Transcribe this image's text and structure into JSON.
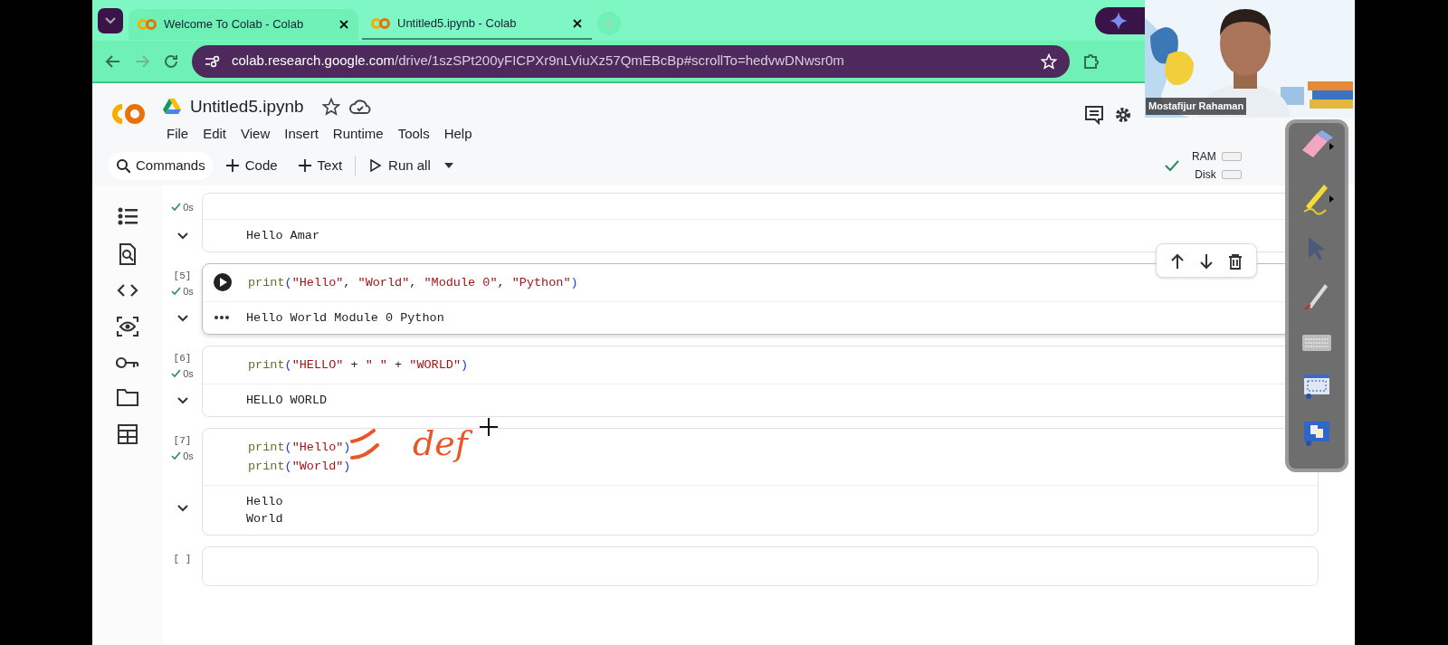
{
  "browser": {
    "tabs": [
      {
        "title": "Welcome To Colab - Colab",
        "selected": false
      },
      {
        "title": "Untitled5.ipynb - Colab",
        "selected": true
      }
    ],
    "url_host": "colab.research.google.com",
    "url_path": "/drive/1szSPt200yFICPXr9nLViuXz57QmEBcBp#scrollTo=hedvwDNwsr0m"
  },
  "notebook": {
    "title": "Untitled5.ipynb",
    "menu": [
      "File",
      "Edit",
      "View",
      "Insert",
      "Runtime",
      "Tools",
      "Help"
    ],
    "toolbar": [
      {
        "kind": "search",
        "label": "Commands"
      },
      {
        "kind": "add",
        "label": "Code"
      },
      {
        "kind": "add",
        "label": "Text"
      },
      {
        "kind": "run",
        "label": "Run all"
      }
    ],
    "resources": [
      {
        "label": "RAM"
      },
      {
        "label": "Disk"
      }
    ]
  },
  "cells": [
    {
      "time": "0s",
      "output": [
        "Hello Amar"
      ],
      "selected": false
    },
    {
      "count": "[5]",
      "time": "0s",
      "code": [
        "print(\"Hello\", \"World\", \"Module 0\", \"Python\")"
      ],
      "output": [
        "Hello World Module 0 Python"
      ],
      "selected": true
    },
    {
      "count": "[6]",
      "time": "0s",
      "code": [
        "print(\"HELLO\" + \" \" + \"WORLD\")"
      ],
      "output": [
        "HELLO WORLD"
      ],
      "selected": false
    },
    {
      "count": "[7]",
      "time": "0s",
      "code": [
        "print(\"Hello\")",
        "print(\"World\")"
      ],
      "output": [
        "Hello",
        "World"
      ],
      "selected": false
    },
    {
      "count": "[ ]",
      "selected": false
    }
  ],
  "annotation": {
    "text": "def"
  },
  "webcam": {
    "name": "Mostafijur Rahaman"
  }
}
